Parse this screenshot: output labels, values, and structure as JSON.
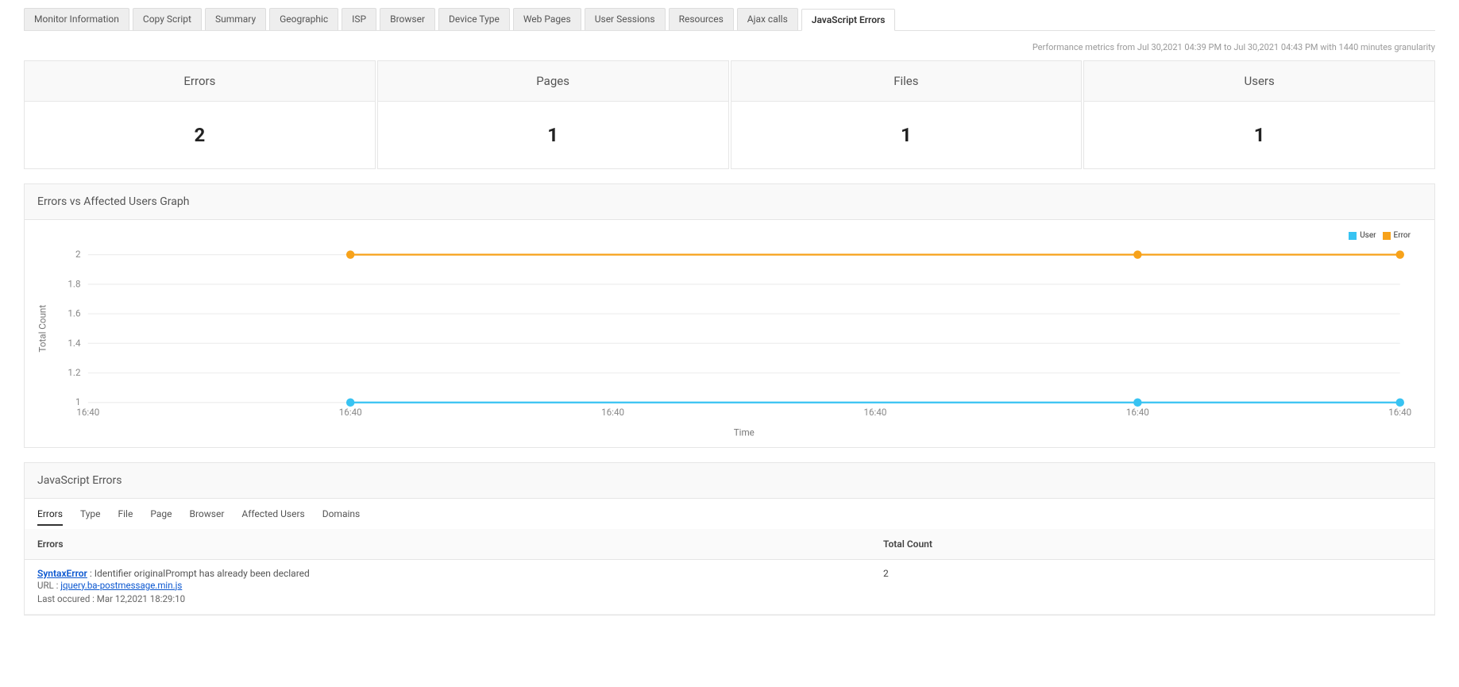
{
  "top_tabs": [
    "Monitor Information",
    "Copy Script",
    "Summary",
    "Geographic",
    "ISP",
    "Browser",
    "Device Type",
    "Web Pages",
    "User Sessions",
    "Resources",
    "Ajax calls",
    "JavaScript Errors"
  ],
  "top_tabs_active": 11,
  "perf_text": "Performance metrics from Jul 30,2021 04:39 PM to Jul 30,2021 04:43 PM with 1440 minutes granularity",
  "kpis": [
    {
      "label": "Errors",
      "value": "2"
    },
    {
      "label": "Pages",
      "value": "1"
    },
    {
      "label": "Files",
      "value": "1"
    },
    {
      "label": "Users",
      "value": "1"
    }
  ],
  "chart_panel_title": "Errors vs Affected Users Graph",
  "chart_data": {
    "type": "line",
    "title": "",
    "xlabel": "Time",
    "ylabel": "Total Count",
    "ylim": [
      1,
      2
    ],
    "yticks": [
      1,
      1.2,
      1.4,
      1.6,
      1.8,
      2
    ],
    "categories": [
      "16:40",
      "16:40",
      "16:40",
      "16:40",
      "16:40",
      "16:40"
    ],
    "series": [
      {
        "name": "User",
        "color": "#38c3f2",
        "values": [
          null,
          1,
          null,
          null,
          1,
          1
        ]
      },
      {
        "name": "Error",
        "color": "#f7a21a",
        "values": [
          null,
          2,
          null,
          null,
          2,
          2
        ]
      }
    ],
    "legend_position": "top-right"
  },
  "js_errors_panel_title": "JavaScript Errors",
  "subtabs": [
    "Errors",
    "Type",
    "File",
    "Page",
    "Browser",
    "Affected Users",
    "Domains"
  ],
  "subtabs_active": 0,
  "table": {
    "columns": [
      "Errors",
      "Total Count"
    ],
    "rows": [
      {
        "error_type": "SyntaxError",
        "error_message": ": Identifier originalPrompt has already been declared",
        "url_label": "URL :",
        "url_value": "jquery.ba-postmessage.min.js",
        "last_label": "Last occured :",
        "last_value": "Mar 12,2021 18:29:10",
        "total_count": "2"
      }
    ]
  }
}
